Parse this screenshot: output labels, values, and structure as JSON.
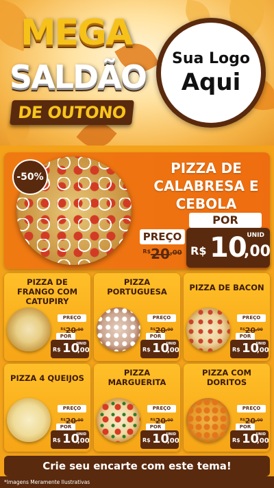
{
  "header": {
    "mega": "MEGA",
    "saldao": "SALDÃO",
    "outono": "DE OUTONO",
    "logo_line1": "Sua Logo",
    "logo_line2": "Aqui"
  },
  "featured": {
    "discount": "-50%",
    "title": "PIZZA DE CALABRESA E CEBOLA",
    "preco_label": "PREÇO",
    "por_label": "POR",
    "old_currency": "R$",
    "old_value": "20",
    "old_cents": ",00",
    "unid_label": "UNID",
    "new_currency": "R$",
    "new_value": "10",
    "new_cents": ",00"
  },
  "products": [
    {
      "title": "PIZZA DE FRANGO COM CATUPIRY",
      "preco_label": "PREÇO",
      "old_currency": "R$",
      "old_value": "20",
      "old_cents": ",00",
      "por_label": "POR",
      "unid_label": "UNID",
      "new_currency": "R$",
      "new_value": "10",
      "new_cents": ",00"
    },
    {
      "title": "PIZZA PORTUGUESA",
      "preco_label": "PREÇO",
      "old_currency": "R$",
      "old_value": "20",
      "old_cents": ",00",
      "por_label": "POR",
      "unid_label": "UNID",
      "new_currency": "R$",
      "new_value": "10",
      "new_cents": ",00"
    },
    {
      "title": "PIZZA DE BACON",
      "preco_label": "PREÇO",
      "old_currency": "R$",
      "old_value": "20",
      "old_cents": ",00",
      "por_label": "POR",
      "unid_label": "UNID",
      "new_currency": "R$",
      "new_value": "10",
      "new_cents": ",00"
    },
    {
      "title": "PIZZA 4 QUEIJOS",
      "preco_label": "PREÇO",
      "old_currency": "R$",
      "old_value": "20",
      "old_cents": ",00",
      "por_label": "POR",
      "unid_label": "UNID",
      "new_currency": "R$",
      "new_value": "10",
      "new_cents": ",00"
    },
    {
      "title": "PIZZA MARGUERITA",
      "preco_label": "PREÇO",
      "old_currency": "R$",
      "old_value": "20",
      "old_cents": ",00",
      "por_label": "POR",
      "unid_label": "UNID",
      "new_currency": "R$",
      "new_value": "10",
      "new_cents": ",00"
    },
    {
      "title": "PIZZA COM DORITOS",
      "preco_label": "PREÇO",
      "old_currency": "R$",
      "old_value": "20",
      "old_cents": ",00",
      "por_label": "POR",
      "unid_label": "UNID",
      "new_currency": "R$",
      "new_value": "10",
      "new_cents": ",00"
    }
  ],
  "footer": {
    "cta": "Crie seu encarte com este tema!",
    "disclaimer": "*Imagens Meramente Ilustrativas"
  },
  "colors": {
    "brown": "#5a2a0e",
    "orange": "#f07a12",
    "yellow": "#ffbf28",
    "gold": "#f6c21a"
  }
}
